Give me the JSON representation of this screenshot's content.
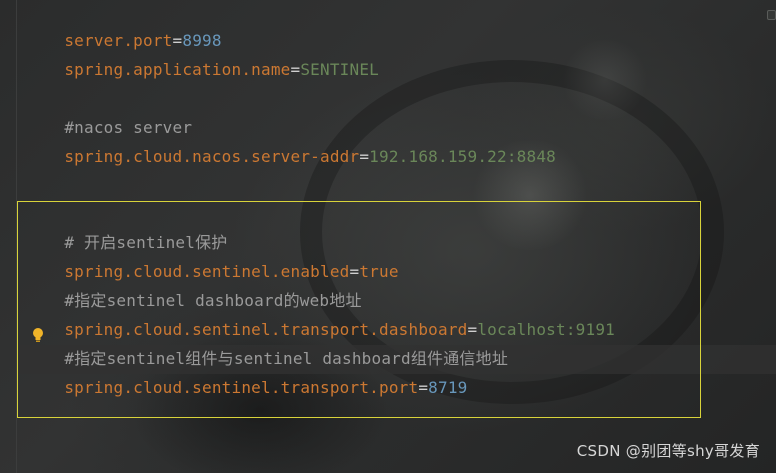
{
  "editor": {
    "lines": [
      {
        "key": "server.port",
        "eq": "=",
        "value": "8998"
      },
      {
        "key": "spring.application.name",
        "eq": "=",
        "value": "SENTINEL"
      },
      {
        "comment": "#nacos server"
      },
      {
        "key": "spring.cloud.nacos.server-addr",
        "eq": "=",
        "value": "192.168.159.22:8848"
      },
      {
        "comment": "# 开启sentinel保护"
      },
      {
        "key": "spring.cloud.sentinel.enabled",
        "eq": "=",
        "value": "true"
      },
      {
        "comment": "#指定sentinel dashboard的web地址"
      },
      {
        "key": "spring.cloud.sentinel.transport.dashboard",
        "eq": "=",
        "value": "localhost:9191"
      },
      {
        "comment": "#指定sentinel组件与sentinel dashboard组件通信地址"
      },
      {
        "key": "spring.cloud.sentinel.transport.port",
        "eq": "=",
        "value": "8719"
      }
    ],
    "intention_icon": "lightbulb-icon"
  },
  "watermark": "CSDN @别团等shy哥发育",
  "colors": {
    "key": "#cc7832",
    "string_value": "#6a8759",
    "number_value": "#6897bb",
    "comment": "#9a9a9a",
    "selection_border": "#d8d33a"
  }
}
